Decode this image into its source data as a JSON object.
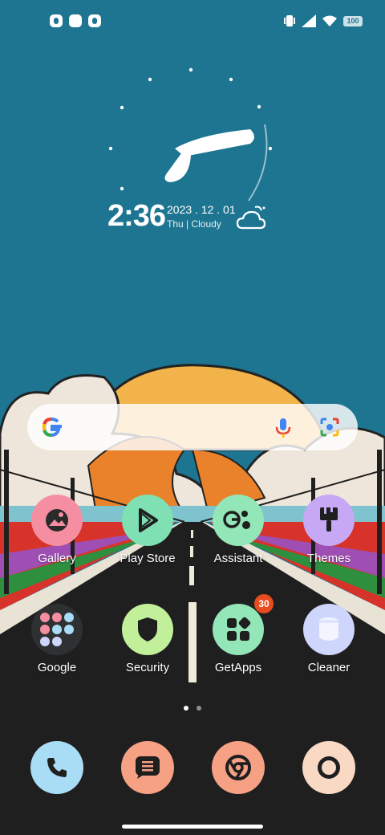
{
  "status_bar": {
    "left_icons": [
      "notification-app-icon",
      "notification-square-icon",
      "notification-app-icon"
    ],
    "right_icons": [
      "vibrate-icon",
      "signal-icon",
      "wifi-icon"
    ],
    "battery": "100"
  },
  "clock_widget": {
    "time": "2:36",
    "date": "2023 . 12 . 01",
    "day_weather": "Thu | Cloudy",
    "weather_icon": "cloudy-night-icon"
  },
  "search_bar": {
    "icons": [
      "google-g-icon",
      "mic-icon",
      "lens-icon"
    ]
  },
  "apps": [
    {
      "label": "Gallery",
      "color": "#f68ea2",
      "icon": "gallery-icon"
    },
    {
      "label": "Play Store",
      "color": "#7fe0b4",
      "icon": "play-store-icon"
    },
    {
      "label": "Assistant",
      "color": "#93e6b8",
      "icon": "assistant-icon"
    },
    {
      "label": "Themes",
      "color": "#c7a8f5",
      "icon": "themes-brush-icon"
    },
    {
      "label": "Google",
      "color": "#2f3032",
      "icon": "google-folder-icon"
    },
    {
      "label": "Security",
      "color": "#c2f09a",
      "icon": "shield-icon"
    },
    {
      "label": "GetApps",
      "color": "#93e6b8",
      "icon": "getapps-icon",
      "badge": "30"
    },
    {
      "label": "Cleaner",
      "color": "#cfd6fb",
      "icon": "cleaner-icon"
    }
  ],
  "page_indicator": {
    "pages": 2,
    "current": 1
  },
  "dock": [
    {
      "name": "phone-icon",
      "color": "#a9dcf5"
    },
    {
      "name": "messages-icon",
      "color": "#f6a184"
    },
    {
      "name": "chrome-icon",
      "color": "#f6a184"
    },
    {
      "name": "camera-icon",
      "color": "#f9d9c4"
    }
  ]
}
